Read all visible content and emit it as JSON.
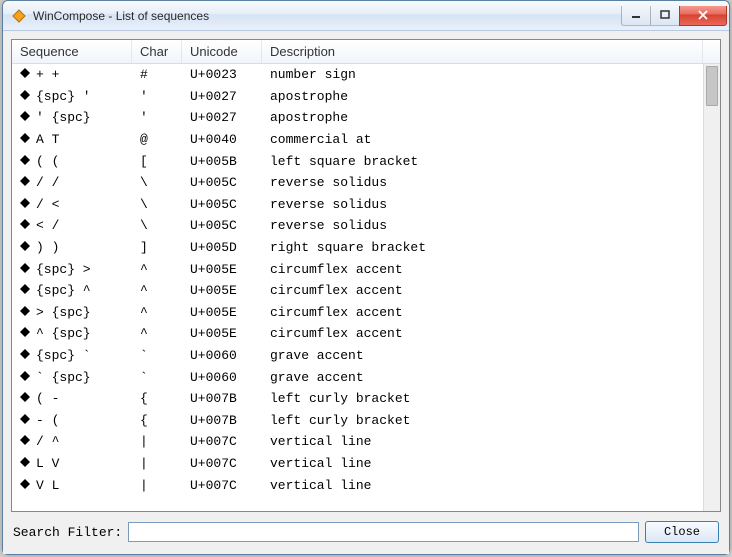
{
  "window": {
    "title": "WinCompose - List of sequences"
  },
  "columns": {
    "sequence": "Sequence",
    "char": "Char",
    "unicode": "Unicode",
    "description": "Description"
  },
  "rows": [
    {
      "sequence": "+ +",
      "char": "#",
      "unicode": "U+0023",
      "description": "number sign"
    },
    {
      "sequence": "{spc} '",
      "char": "'",
      "unicode": "U+0027",
      "description": "apostrophe"
    },
    {
      "sequence": "' {spc}",
      "char": "'",
      "unicode": "U+0027",
      "description": "apostrophe"
    },
    {
      "sequence": "A T",
      "char": "@",
      "unicode": "U+0040",
      "description": "commercial at"
    },
    {
      "sequence": "( (",
      "char": "[",
      "unicode": "U+005B",
      "description": "left square bracket"
    },
    {
      "sequence": "/ /",
      "char": "\\",
      "unicode": "U+005C",
      "description": "reverse solidus"
    },
    {
      "sequence": "/ <",
      "char": "\\",
      "unicode": "U+005C",
      "description": "reverse solidus"
    },
    {
      "sequence": "< /",
      "char": "\\",
      "unicode": "U+005C",
      "description": "reverse solidus"
    },
    {
      "sequence": ") )",
      "char": "]",
      "unicode": "U+005D",
      "description": "right square bracket"
    },
    {
      "sequence": "{spc} >",
      "char": "^",
      "unicode": "U+005E",
      "description": "circumflex accent"
    },
    {
      "sequence": "{spc} ^",
      "char": "^",
      "unicode": "U+005E",
      "description": "circumflex accent"
    },
    {
      "sequence": "> {spc}",
      "char": "^",
      "unicode": "U+005E",
      "description": "circumflex accent"
    },
    {
      "sequence": "^ {spc}",
      "char": "^",
      "unicode": "U+005E",
      "description": "circumflex accent"
    },
    {
      "sequence": "{spc} `",
      "char": "`",
      "unicode": "U+0060",
      "description": "grave accent"
    },
    {
      "sequence": "` {spc}",
      "char": "`",
      "unicode": "U+0060",
      "description": "grave accent"
    },
    {
      "sequence": "( -",
      "char": "{",
      "unicode": "U+007B",
      "description": "left curly bracket"
    },
    {
      "sequence": "- (",
      "char": "{",
      "unicode": "U+007B",
      "description": "left curly bracket"
    },
    {
      "sequence": "/ ^",
      "char": "|",
      "unicode": "U+007C",
      "description": "vertical line"
    },
    {
      "sequence": "L V",
      "char": "|",
      "unicode": "U+007C",
      "description": "vertical line"
    },
    {
      "sequence": "V L",
      "char": "|",
      "unicode": "U+007C",
      "description": "vertical line"
    }
  ],
  "footer": {
    "search_label": "Search Filter:",
    "search_value": "",
    "close_label": "Close"
  }
}
